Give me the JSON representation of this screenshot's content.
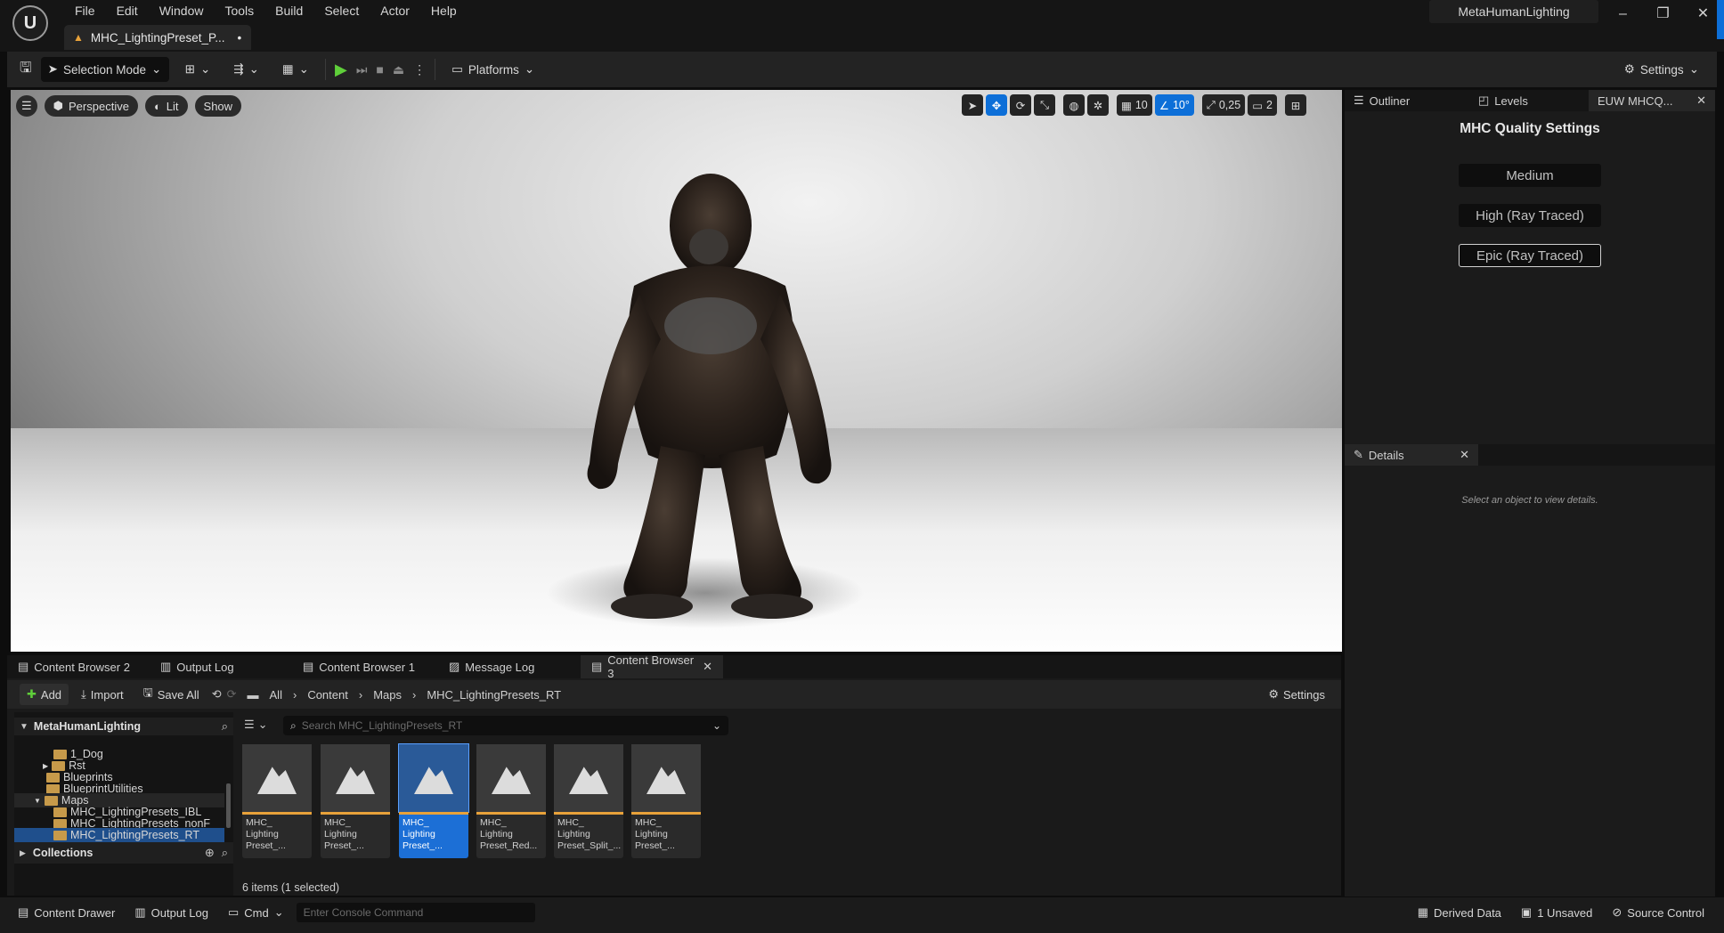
{
  "app": {
    "project_name": "MetaHumanLighting",
    "document_tab": "MHC_LightingPreset_P...",
    "menu": [
      "File",
      "Edit",
      "Window",
      "Tools",
      "Build",
      "Select",
      "Actor",
      "Help"
    ]
  },
  "toolbar": {
    "selection_mode": "Selection Mode",
    "platforms": "Platforms",
    "settings": "Settings"
  },
  "viewport": {
    "perspective": "Perspective",
    "lit": "Lit",
    "show": "Show",
    "grid_snap": "10",
    "rotate_snap": "10°",
    "scale_snap": "0,25",
    "camera_speed": "2"
  },
  "right_panel": {
    "tabs": [
      "Outliner",
      "Levels",
      "EUW MHCQ..."
    ],
    "title": "MHC Quality Settings",
    "buttons": [
      "Medium",
      "High (Ray Traced)",
      "Epic (Ray Traced)"
    ],
    "details_tab": "Details",
    "details_hint": "Select an object to view details."
  },
  "content_browser": {
    "tabs": [
      "Content Browser 2",
      "Output Log",
      "Content Browser 1",
      "Message Log",
      "Content Browser 3"
    ],
    "add": "Add",
    "import": "Import",
    "save_all": "Save All",
    "breadcrumb": [
      "All",
      "Content",
      "Maps",
      "MHC_LightingPresets_RT"
    ],
    "settings": "Settings",
    "tree_root": "MetaHumanLighting",
    "tree_items": [
      "1_Dog",
      "Rst",
      "Blueprints",
      "BlueprintUtilities",
      "Maps",
      "MHC_LightingPresets_IBL",
      "MHC_LightingPresets_nonF",
      "MHC_LightingPresets_RT"
    ],
    "collections": "Collections",
    "search_placeholder": "Search MHC_LightingPresets_RT",
    "assets": [
      "MHC_\nLighting\nPreset_...",
      "MHC_\nLighting\nPreset_...",
      "MHC_\nLighting\nPreset_...",
      "MHC_\nLighting\nPreset_Red...",
      "MHC_\nLighting\nPreset_Split_...",
      "MHC_\nLighting\nPreset_..."
    ],
    "item_count": "6 items (1 selected)"
  },
  "statusbar": {
    "content_drawer": "Content Drawer",
    "output_log": "Output Log",
    "cmd": "Cmd",
    "console_placeholder": "Enter Console Command",
    "derived_data": "Derived Data",
    "unsaved": "1 Unsaved",
    "source_control": "Source Control"
  }
}
